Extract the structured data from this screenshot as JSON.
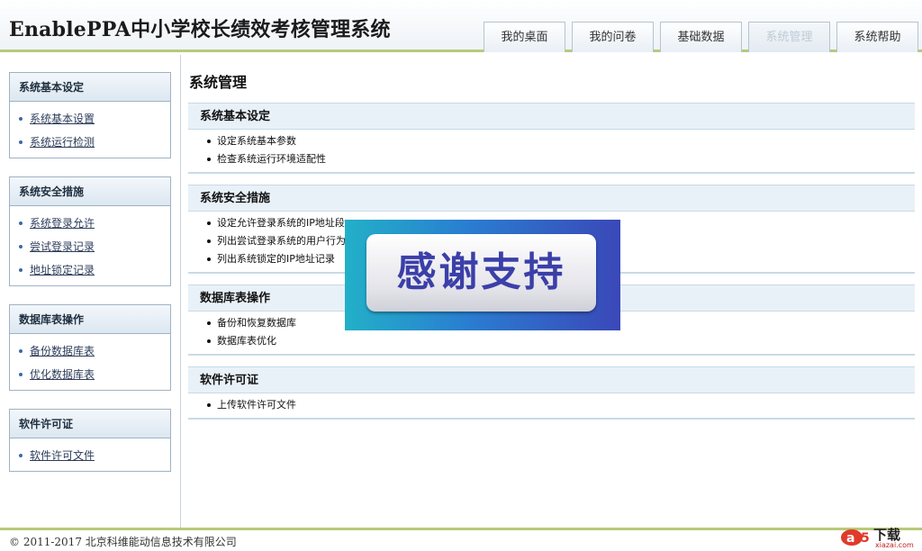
{
  "header": {
    "title": "EnablePPA中小学校长绩效考核管理系统",
    "tabs": [
      {
        "label": "我的桌面",
        "active": false
      },
      {
        "label": "我的问卷",
        "active": false
      },
      {
        "label": "基础数据",
        "active": false
      },
      {
        "label": "系统管理",
        "active": true
      },
      {
        "label": "系统帮助",
        "active": false
      }
    ]
  },
  "sidebar": {
    "groups": [
      {
        "title": "系统基本设定",
        "items": [
          "系统基本设置",
          "系统运行检测"
        ]
      },
      {
        "title": "系统安全措施",
        "items": [
          "系统登录允许",
          "尝试登录记录",
          "地址锁定记录"
        ]
      },
      {
        "title": "数据库表操作",
        "items": [
          "备份数据库表",
          "优化数据库表"
        ]
      },
      {
        "title": "软件许可证",
        "items": [
          "软件许可文件"
        ]
      }
    ]
  },
  "main": {
    "title": "系统管理",
    "sections": [
      {
        "title": "系统基本设定",
        "items": [
          "设定系统基本参数",
          "检查系统运行环境适配性"
        ]
      },
      {
        "title": "系统安全措施",
        "items": [
          "设定允许登录系统的IP地址段",
          "列出尝试登录系统的用户行为",
          "列出系统锁定的IP地址记录"
        ]
      },
      {
        "title": "数据库表操作",
        "items": [
          "备份和恢复数据库",
          "数据库表优化"
        ]
      },
      {
        "title": "软件许可证",
        "items": [
          "上传软件许可文件"
        ]
      }
    ]
  },
  "overlay": {
    "text": "感谢支持"
  },
  "footer": {
    "copyright": "© 2011-2017 北京科维能动信息技术有限公司",
    "brand_name": "下载",
    "brand_url": "xiazai.com"
  },
  "colors": {
    "accent_border": "#b9c97a",
    "sidebar_border": "#9fb2c4",
    "section_header_bg": "#e9f1f8",
    "overlay_text": "#3b3fa8"
  }
}
